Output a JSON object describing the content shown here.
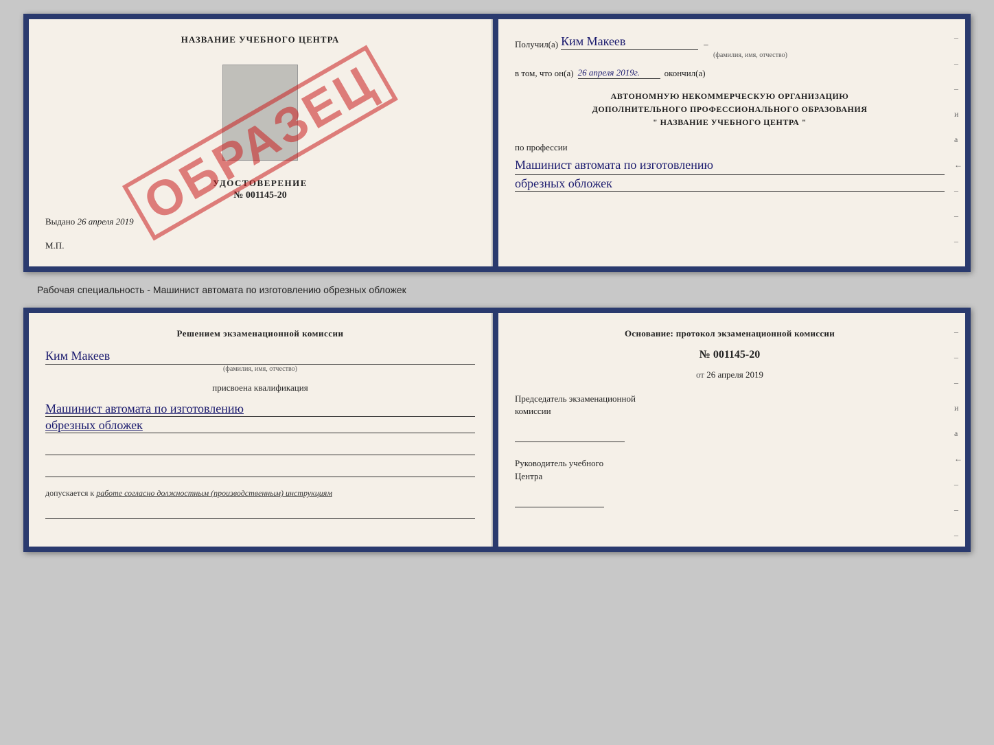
{
  "top_doc": {
    "left": {
      "school_name": "НАЗВАНИЕ УЧЕБНОГО ЦЕНТРА",
      "udostoverenie_label": "УДОСТОВЕРЕНИЕ",
      "udostoverenie_num": "№ 001145-20",
      "vydano_label": "Выдано",
      "vydano_date": "26 апреля 2019",
      "mp_label": "М.П.",
      "obrazets": "ОБРАЗЕЦ"
    },
    "right": {
      "poluchil_label": "Получил(а)",
      "poluchil_name": "Ким Макеев",
      "poluchil_sub": "(фамилия, имя, отчество)",
      "dash": "–",
      "vtom_label": "в том, что он(а)",
      "vtom_date": "26 апреля 2019г.",
      "okonchil_label": "окончил(а)",
      "org_line1": "АВТОНОМНУЮ НЕКОММЕРЧЕСКУЮ ОРГАНИЗАЦИЮ",
      "org_line2": "ДОПОЛНИТЕЛЬНОГО ПРОФЕССИОНАЛЬНОГО ОБРАЗОВАНИЯ",
      "org_quotes": "\"   НАЗВАНИЕ УЧЕБНОГО ЦЕНТРА   \"",
      "po_professii": "по профессии",
      "profession_line1": "Машинист автомата по изготовлению",
      "profession_line2": "обрезных обложек",
      "dashes": [
        "–",
        "–",
        "–",
        "и",
        "а",
        "←",
        "–",
        "–",
        "–"
      ]
    }
  },
  "between_label": "Рабочая специальность - Машинист автомата по изготовлению обрезных обложек",
  "bottom_doc": {
    "left": {
      "resheniyem_line1": "Решением экзаменационной комиссии",
      "kim_name": "Ким Макеев",
      "fio_sub": "(фамилия, имя, отчество)",
      "prisvoena": "присвоена квалификация",
      "kval_line1": "Машинист автомата по изготовлению",
      "kval_line2": "обрезных обложек",
      "dopuskaetsya_prefix": "допускается к",
      "dopuskaetsya_text": "работе согласно должностным (производственным) инструкциям"
    },
    "right": {
      "osnovanie": "Основание: протокол экзаменационной комиссии",
      "protocol_num": "№  001145-20",
      "ot_label": "от",
      "protocol_date": "26 апреля 2019",
      "predsedatel_line1": "Председатель экзаменационной",
      "predsedatel_line2": "комиссии",
      "rukovoditel_line1": "Руководитель учебного",
      "rukovoditel_line2": "Центра",
      "dashes": [
        "–",
        "–",
        "–",
        "и",
        "а",
        "←",
        "–",
        "–",
        "–"
      ]
    }
  }
}
